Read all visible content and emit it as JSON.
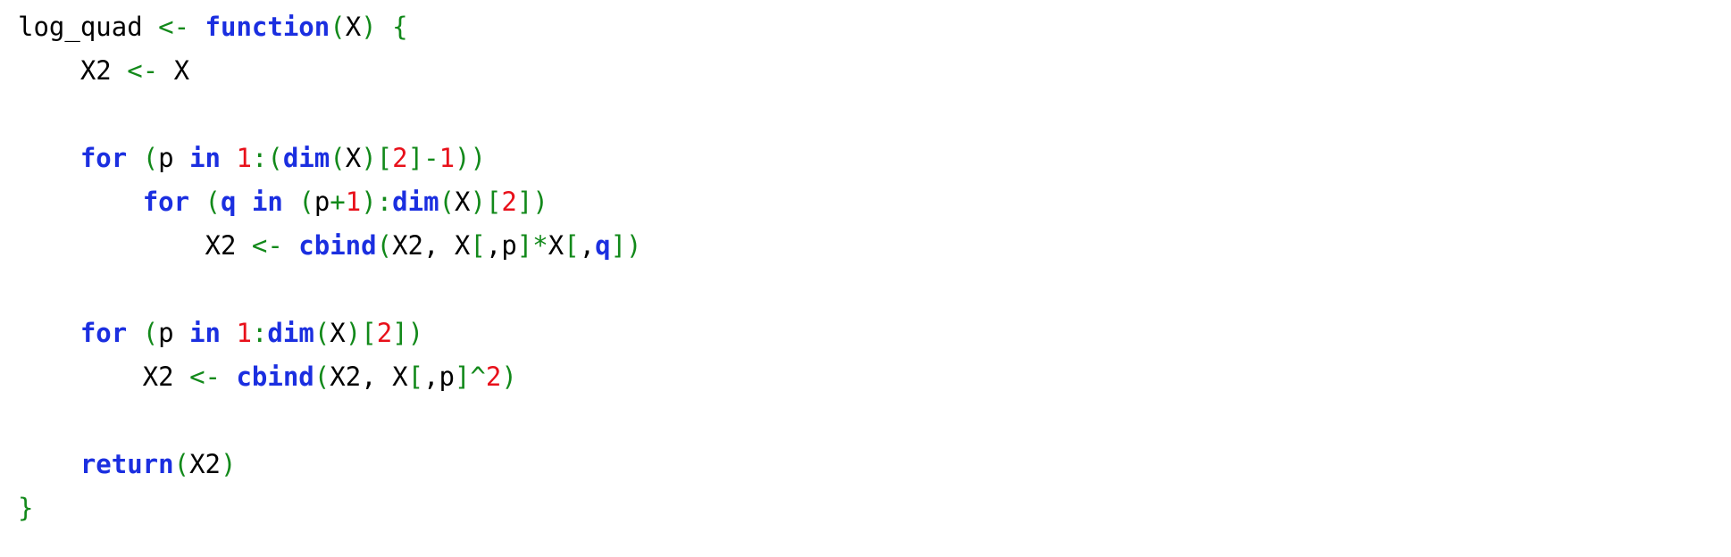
{
  "editor": {
    "language": "R",
    "colors": {
      "background": "#ffffff",
      "identifier": "#000000",
      "keyword": "#1b2fe0",
      "operator": "#12891a",
      "bracket": "#12891a",
      "number": "#e8101a"
    },
    "lines": [
      [
        {
          "t": "log_quad",
          "k": "id"
        },
        {
          "t": " ",
          "k": "id"
        },
        {
          "t": "<-",
          "k": "op"
        },
        {
          "t": " ",
          "k": "id"
        },
        {
          "t": "function",
          "k": "kw"
        },
        {
          "t": "(",
          "k": "br"
        },
        {
          "t": "X",
          "k": "id"
        },
        {
          "t": ")",
          "k": "br"
        },
        {
          "t": " ",
          "k": "id"
        },
        {
          "t": "{",
          "k": "br"
        }
      ],
      [
        {
          "t": "    X2",
          "k": "id"
        },
        {
          "t": " ",
          "k": "id"
        },
        {
          "t": "<-",
          "k": "op"
        },
        {
          "t": " X",
          "k": "id"
        }
      ],
      [],
      [
        {
          "t": "    ",
          "k": "id"
        },
        {
          "t": "for",
          "k": "kw"
        },
        {
          "t": " ",
          "k": "id"
        },
        {
          "t": "(",
          "k": "br"
        },
        {
          "t": "p ",
          "k": "id"
        },
        {
          "t": "in",
          "k": "kw"
        },
        {
          "t": " ",
          "k": "id"
        },
        {
          "t": "1",
          "k": "num"
        },
        {
          "t": ":",
          "k": "op"
        },
        {
          "t": "(",
          "k": "br"
        },
        {
          "t": "dim",
          "k": "kw"
        },
        {
          "t": "(",
          "k": "br"
        },
        {
          "t": "X",
          "k": "id"
        },
        {
          "t": ")",
          "k": "br"
        },
        {
          "t": "[",
          "k": "br"
        },
        {
          "t": "2",
          "k": "num"
        },
        {
          "t": "]",
          "k": "br"
        },
        {
          "t": "-",
          "k": "op"
        },
        {
          "t": "1",
          "k": "num"
        },
        {
          "t": "))",
          "k": "br"
        }
      ],
      [
        {
          "t": "        ",
          "k": "id"
        },
        {
          "t": "for",
          "k": "kw"
        },
        {
          "t": " ",
          "k": "id"
        },
        {
          "t": "(",
          "k": "br"
        },
        {
          "t": "q",
          "k": "kw"
        },
        {
          "t": " ",
          "k": "id"
        },
        {
          "t": "in",
          "k": "kw"
        },
        {
          "t": " ",
          "k": "id"
        },
        {
          "t": "(",
          "k": "br"
        },
        {
          "t": "p",
          "k": "id"
        },
        {
          "t": "+",
          "k": "op"
        },
        {
          "t": "1",
          "k": "num"
        },
        {
          "t": ")",
          "k": "br"
        },
        {
          "t": ":",
          "k": "op"
        },
        {
          "t": "dim",
          "k": "kw"
        },
        {
          "t": "(",
          "k": "br"
        },
        {
          "t": "X",
          "k": "id"
        },
        {
          "t": ")",
          "k": "br"
        },
        {
          "t": "[",
          "k": "br"
        },
        {
          "t": "2",
          "k": "num"
        },
        {
          "t": "])",
          "k": "br"
        }
      ],
      [
        {
          "t": "            X2",
          "k": "id"
        },
        {
          "t": " ",
          "k": "id"
        },
        {
          "t": "<-",
          "k": "op"
        },
        {
          "t": " ",
          "k": "id"
        },
        {
          "t": "cbind",
          "k": "kw"
        },
        {
          "t": "(",
          "k": "br"
        },
        {
          "t": "X2, X",
          "k": "id"
        },
        {
          "t": "[",
          "k": "br"
        },
        {
          "t": ",p",
          "k": "id"
        },
        {
          "t": "]",
          "k": "br"
        },
        {
          "t": "*",
          "k": "op"
        },
        {
          "t": "X",
          "k": "id"
        },
        {
          "t": "[",
          "k": "br"
        },
        {
          "t": ",",
          "k": "id"
        },
        {
          "t": "q",
          "k": "kw"
        },
        {
          "t": "])",
          "k": "br"
        }
      ],
      [],
      [
        {
          "t": "    ",
          "k": "id"
        },
        {
          "t": "for",
          "k": "kw"
        },
        {
          "t": " ",
          "k": "id"
        },
        {
          "t": "(",
          "k": "br"
        },
        {
          "t": "p ",
          "k": "id"
        },
        {
          "t": "in",
          "k": "kw"
        },
        {
          "t": " ",
          "k": "id"
        },
        {
          "t": "1",
          "k": "num"
        },
        {
          "t": ":",
          "k": "op"
        },
        {
          "t": "dim",
          "k": "kw"
        },
        {
          "t": "(",
          "k": "br"
        },
        {
          "t": "X",
          "k": "id"
        },
        {
          "t": ")",
          "k": "br"
        },
        {
          "t": "[",
          "k": "br"
        },
        {
          "t": "2",
          "k": "num"
        },
        {
          "t": "])",
          "k": "br"
        }
      ],
      [
        {
          "t": "        X2",
          "k": "id"
        },
        {
          "t": " ",
          "k": "id"
        },
        {
          "t": "<-",
          "k": "op"
        },
        {
          "t": " ",
          "k": "id"
        },
        {
          "t": "cbind",
          "k": "kw"
        },
        {
          "t": "(",
          "k": "br"
        },
        {
          "t": "X2, X",
          "k": "id"
        },
        {
          "t": "[",
          "k": "br"
        },
        {
          "t": ",p",
          "k": "id"
        },
        {
          "t": "]",
          "k": "br"
        },
        {
          "t": "^",
          "k": "op"
        },
        {
          "t": "2",
          "k": "num"
        },
        {
          "t": ")",
          "k": "br"
        }
      ],
      [],
      [
        {
          "t": "    ",
          "k": "id"
        },
        {
          "t": "return",
          "k": "kw"
        },
        {
          "t": "(",
          "k": "br"
        },
        {
          "t": "X2",
          "k": "id"
        },
        {
          "t": ")",
          "k": "br"
        }
      ],
      [
        {
          "t": "}",
          "k": "br"
        }
      ]
    ]
  }
}
